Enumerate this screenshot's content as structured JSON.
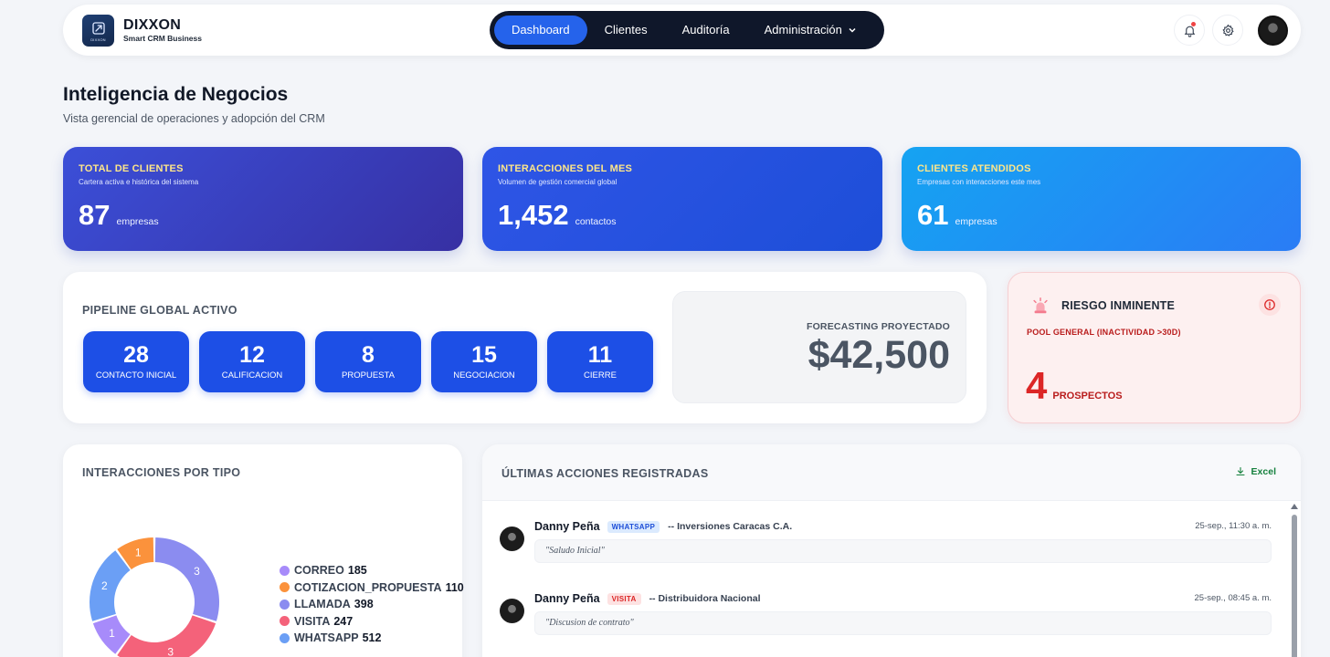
{
  "brand": {
    "name": "DIXXON",
    "tagline": "Smart CRM Business",
    "logo_text": "DIXXON"
  },
  "nav": {
    "items": [
      {
        "label": "Dashboard",
        "active": true
      },
      {
        "label": "Clientes",
        "active": false
      },
      {
        "label": "Auditoría",
        "active": false
      },
      {
        "label": "Administración",
        "active": false,
        "has_dropdown": true
      }
    ],
    "icons": [
      "bell-icon",
      "gear-icon",
      "avatar"
    ]
  },
  "header": {
    "title": "Inteligencia de Negocios",
    "subtitle": "Vista gerencial de operaciones y adopción del CRM"
  },
  "kpis": [
    {
      "title": "TOTAL DE CLIENTES",
      "subtitle": "Cartera activa e histórica del sistema",
      "value": "87",
      "unit": "empresas"
    },
    {
      "title": "INTERACCIONES DEL MES",
      "subtitle": "Volumen de gestión comercial global",
      "value": "1,452",
      "unit": "contactos"
    },
    {
      "title": "CLIENTES ATENDIDOS",
      "subtitle": "Empresas con interacciones este mes",
      "value": "61",
      "unit": "empresas"
    }
  ],
  "pipeline": {
    "title": "PIPELINE GLOBAL ACTIVO",
    "stages": [
      {
        "count": "28",
        "label": "CONTACTO INICIAL"
      },
      {
        "count": "12",
        "label": "CALIFICACION"
      },
      {
        "count": "8",
        "label": "PROPUESTA"
      },
      {
        "count": "15",
        "label": "NEGOCIACION"
      },
      {
        "count": "11",
        "label": "CIERRE"
      }
    ],
    "forecast_label": "FORECASTING PROYECTADO",
    "forecast_value": "$42,500"
  },
  "risk": {
    "title": "RIESGO INMINENTE",
    "subtitle": "POOL GENERAL (INACTIVIDAD >30D)",
    "value": "4",
    "unit": "PROSPECTOS"
  },
  "interaction_types": {
    "title": "INTERACCIONES POR TIPO",
    "legend": [
      {
        "label": "CORREO",
        "value": "185",
        "color": "#a78bfa"
      },
      {
        "label": "COTIZACION_PROPUESTA",
        "value": "110",
        "color": "#fb923c"
      },
      {
        "label": "LLAMADA",
        "value": "398",
        "color": "#8b8cf0"
      },
      {
        "label": "VISITA",
        "value": "247",
        "color": "#f4627a"
      },
      {
        "label": "WHATSAPP",
        "value": "512",
        "color": "#6b9ff5"
      }
    ],
    "donut_slices": [
      {
        "label": "3",
        "value": 3,
        "color": "#8b8cf0"
      },
      {
        "label": "3",
        "value": 3,
        "color": "#f4627a"
      },
      {
        "label": "1",
        "value": 1,
        "color": "#a78bfa"
      },
      {
        "label": "2",
        "value": 2,
        "color": "#6b9ff5"
      },
      {
        "label": "1",
        "value": 1,
        "color": "#fb923c"
      }
    ]
  },
  "actions": {
    "title": "ÚLTIMAS ACCIONES REGISTRADAS",
    "export_label": "Excel",
    "items": [
      {
        "user": "Danny Peña",
        "channel": "WHATSAPP",
        "company": "-- Inversiones Caracas C.A.",
        "time": "25-sep., 11:30 a. m.",
        "note": "\"Saludo Inicial\""
      },
      {
        "user": "Danny Peña",
        "channel": "VISITA",
        "company": "-- Distribuidora Nacional",
        "time": "25-sep., 08:45 a. m.",
        "note": "\"Discusion de contrato\""
      }
    ]
  }
}
